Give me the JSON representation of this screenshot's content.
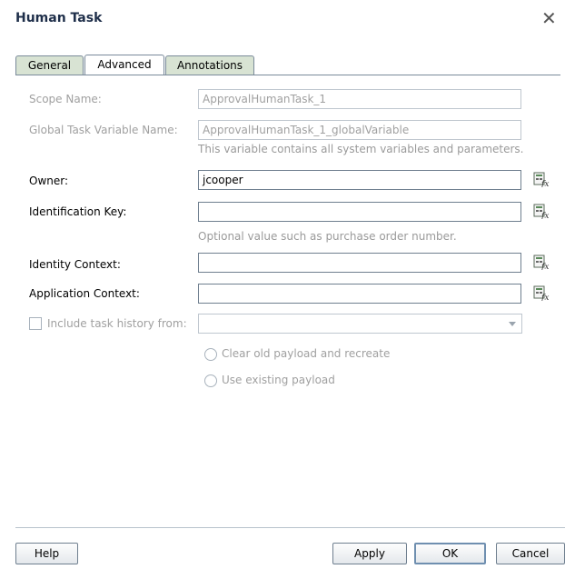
{
  "dialog": {
    "title": "Human Task"
  },
  "tabs": [
    {
      "label": "General"
    },
    {
      "label": "Advanced"
    },
    {
      "label": "Annotations"
    }
  ],
  "form": {
    "scope_name": {
      "label": "Scope Name:",
      "value": "ApprovalHumanTask_1"
    },
    "global_task_variable": {
      "label": "Global Task Variable Name:",
      "value": "ApprovalHumanTask_1_globalVariable",
      "hint": "This variable contains all system variables and parameters."
    },
    "owner": {
      "label": "Owner:",
      "value": "jcooper"
    },
    "identification_key": {
      "label": "Identification Key:",
      "value": "",
      "hint": "Optional value such as purchase order number."
    },
    "identity_context": {
      "label": "Identity Context:",
      "value": ""
    },
    "application_context": {
      "label": "Application Context:",
      "value": ""
    },
    "include_history": {
      "label": "Include task history from:",
      "checked": false,
      "value": ""
    },
    "payload_options": [
      {
        "label": "Clear old payload and recreate"
      },
      {
        "label": "Use existing payload"
      }
    ]
  },
  "buttons": {
    "help": "Help",
    "apply": "Apply",
    "ok": "OK",
    "cancel": "Cancel"
  },
  "icons": {
    "close": "close-icon",
    "expression_builder": "expression-builder-icon"
  }
}
